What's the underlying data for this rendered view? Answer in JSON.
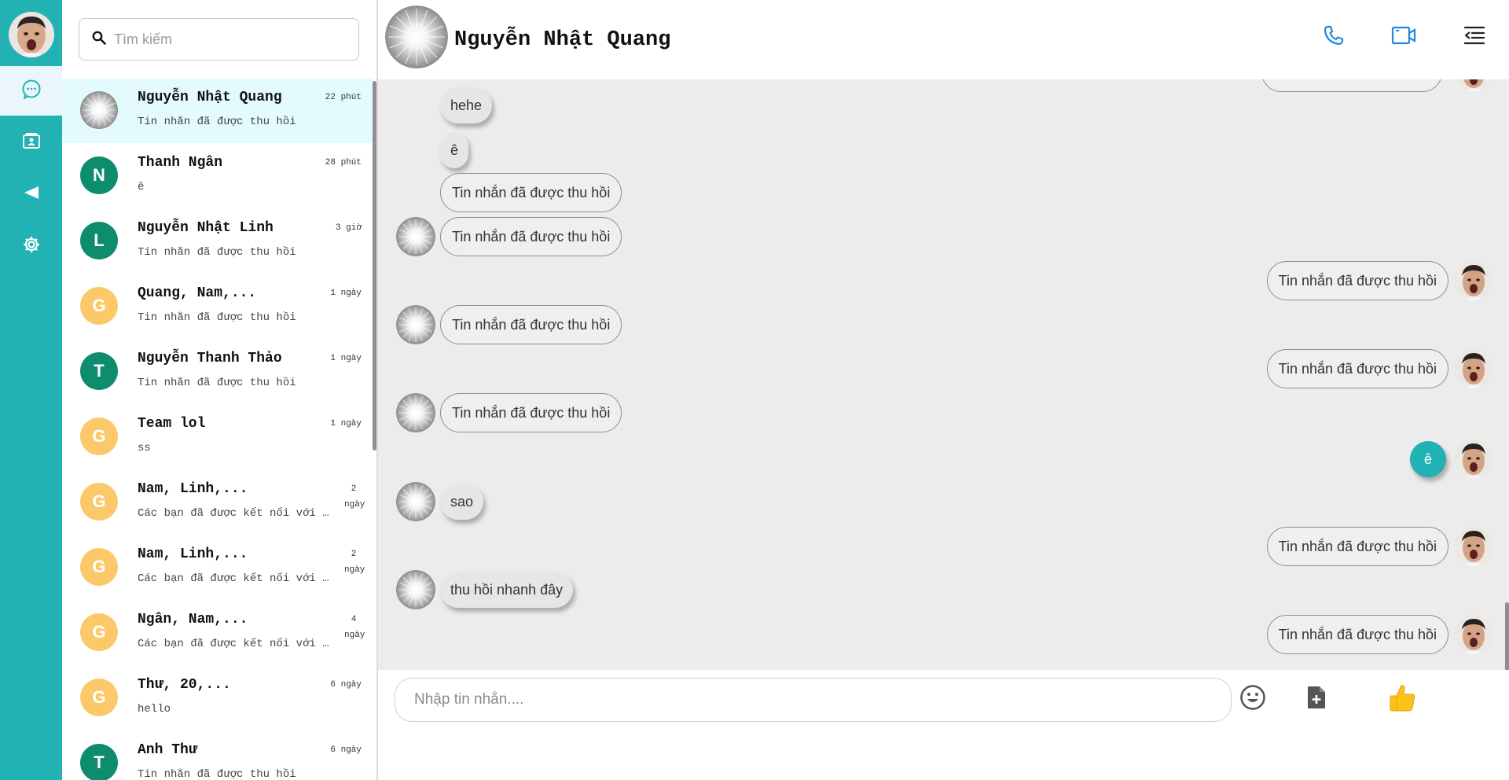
{
  "nav": {
    "items": [
      "chat-icon",
      "contacts-icon",
      "send-icon",
      "settings-icon"
    ],
    "accent": "#22b2b3"
  },
  "search": {
    "placeholder": "Tìm kiếm"
  },
  "conversations": [
    {
      "name": "Nguyễn Nhật Quang",
      "preview": "Tin nhắn đã được thu hồi",
      "time": "22 phút",
      "avatar_letter": "",
      "avatar_color": "#cfcfcf",
      "active": true
    },
    {
      "name": "Thanh Ngân",
      "preview": "ê",
      "time": "28 phút",
      "avatar_letter": "N",
      "avatar_color": "#0e8c6e"
    },
    {
      "name": "Nguyễn Nhật Linh",
      "preview": "Tin nhắn đã được thu hồi",
      "time": "3 giờ",
      "avatar_letter": "L",
      "avatar_color": "#0e8c6e"
    },
    {
      "name": "Quang, Nam,...",
      "preview": "Tin nhắn đã được thu hồi",
      "time": "1 ngày",
      "avatar_letter": "G",
      "avatar_color": "#fcc96a"
    },
    {
      "name": "Nguyễn Thanh Thảo",
      "preview": "Tin nhắn đã được thu hồi",
      "time": "1 ngày",
      "avatar_letter": "T",
      "avatar_color": "#0e8c6e"
    },
    {
      "name": "Team lol",
      "preview": "ss",
      "time": "1 ngày",
      "avatar_letter": "G",
      "avatar_color": "#fcc96a"
    },
    {
      "name": "Nam, Linh,...",
      "preview": "Các bạn đã được kết nối với nhau",
      "time": "2 ngày",
      "avatar_letter": "G",
      "avatar_color": "#fcc96a"
    },
    {
      "name": "Nam, Linh,...",
      "preview": "Các bạn đã được kết nối với nhau",
      "time": "2 ngày",
      "avatar_letter": "G",
      "avatar_color": "#fcc96a"
    },
    {
      "name": "Ngân, Nam,...",
      "preview": "Các bạn đã được kết nối với nhau",
      "time": "4 ngày",
      "avatar_letter": "G",
      "avatar_color": "#fcc96a"
    },
    {
      "name": "Thư, 20,...",
      "preview": "hello",
      "time": "6 ngày",
      "avatar_letter": "G",
      "avatar_color": "#fcc96a"
    },
    {
      "name": "Anh Thư",
      "preview": "Tin nhắn đã được thu hồi",
      "time": "6 ngày",
      "avatar_letter": "T",
      "avatar_color": "#0e8c6e"
    }
  ],
  "chat": {
    "title": "Nguyễn Nhật Quang",
    "messages": [
      {
        "side": "left",
        "text": "hehe",
        "style": "plain",
        "avatar": false
      },
      {
        "side": "left",
        "text": "ê",
        "style": "plain",
        "avatar": false
      },
      {
        "side": "left",
        "text": "Tin nhắn đã được thu hồi",
        "style": "outline",
        "avatar": false
      },
      {
        "side": "left",
        "text": "Tin nhắn đã được thu hồi",
        "style": "outline",
        "avatar": true
      },
      {
        "side": "right",
        "text": "Tin nhắn đã được thu hồi",
        "style": "outline",
        "avatar": true
      },
      {
        "side": "left",
        "text": "Tin nhắn đã được thu hồi",
        "style": "outline",
        "avatar": true
      },
      {
        "side": "right",
        "text": "Tin nhắn đã được thu hồi",
        "style": "outline",
        "avatar": true
      },
      {
        "side": "left",
        "text": "Tin nhắn đã được thu hồi",
        "style": "outline",
        "avatar": true
      },
      {
        "side": "right",
        "text": "ê",
        "style": "teal",
        "avatar": true
      },
      {
        "side": "left",
        "text": "sao",
        "style": "plain",
        "avatar": true
      },
      {
        "side": "right",
        "text": "Tin nhắn đã được thu hồi",
        "style": "outline",
        "avatar": true
      },
      {
        "side": "left",
        "text": "thu hồi nhanh đây",
        "style": "plain",
        "avatar": true
      },
      {
        "side": "right",
        "text": "Tin nhắn đã được thu hồi",
        "style": "outline",
        "avatar": true
      }
    ]
  },
  "composer": {
    "placeholder": "Nhập tin nhắn...."
  },
  "header_actions": [
    "phone-icon",
    "video-icon",
    "menu-icon"
  ],
  "composer_actions": [
    "emoji-icon",
    "file-add-icon",
    "like-icon"
  ]
}
